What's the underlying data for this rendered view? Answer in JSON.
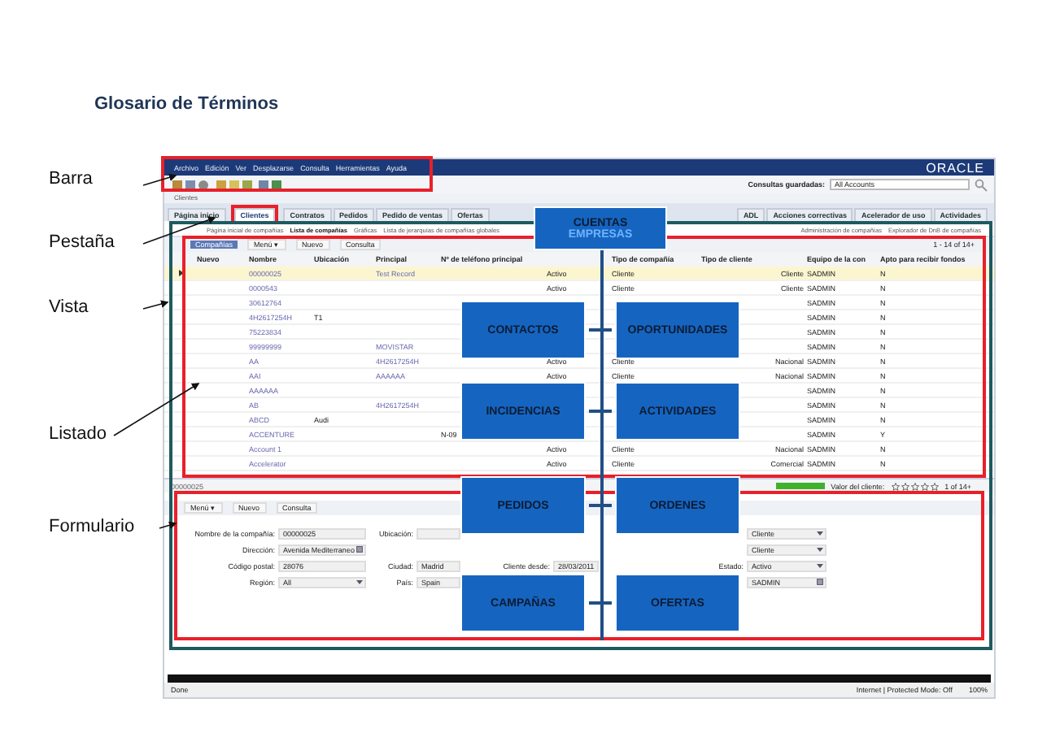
{
  "slide_title": "Glosario de Términos",
  "callouts": [
    {
      "label": "Barra"
    },
    {
      "label": "Pestaña"
    },
    {
      "label": "Vista"
    },
    {
      "label": "Listado"
    },
    {
      "label": "Formulario"
    }
  ],
  "app": {
    "menu": [
      "Archivo",
      "Edición",
      "Ver",
      "Desplazarse",
      "Consulta",
      "Herramientas",
      "Ayuda"
    ],
    "logo": "ORACLE",
    "saved_queries": {
      "label": "Consultas guardadas:",
      "value": "All Accounts"
    },
    "screen_label": "Clientes",
    "tabs": [
      {
        "label": "Página inicio",
        "selected": false
      },
      {
        "label": "Clientes",
        "selected": true
      },
      {
        "label": "Contratos",
        "selected": false
      },
      {
        "label": "Pedidos",
        "selected": false
      },
      {
        "label": "Pedido de ventas",
        "selected": false
      },
      {
        "label": "Ofertas",
        "selected": false
      },
      {
        "label": "ADL",
        "selected": false
      },
      {
        "label": "Acciones correctivas",
        "selected": false
      },
      {
        "label": "Acelerador de uso",
        "selected": false
      },
      {
        "label": "Actividades",
        "selected": false
      }
    ],
    "subtabs": [
      {
        "label": "Página inicial de compañías",
        "selected": false
      },
      {
        "label": "Lista de compañías",
        "selected": true
      },
      {
        "label": "Gráficas",
        "selected": false
      },
      {
        "label": "Lista de jerarquías de compañías globales",
        "selected": false
      },
      {
        "label": "Administración de compañías",
        "selected": false
      },
      {
        "label": "Explorador de DnB de compañías",
        "selected": false
      }
    ],
    "list": {
      "title": "Compañías",
      "menu": "Menú ▾",
      "buttons": [
        "Nuevo",
        "Consulta"
      ],
      "count": "1 - 14 of 14+",
      "columns": [
        "Nuevo",
        "Nombre",
        "Ubicación",
        "Principal",
        "Nº de teléfono principal",
        "Tipo de compañía",
        "Tipo de cliente",
        "Equipo de la con",
        "Apto para recibir fondos"
      ],
      "rows": [
        {
          "selected": true,
          "name": "00000025",
          "primary": "Test Record",
          "status": "Activo",
          "company_type": "Cliente",
          "client_type": "Cliente",
          "team": "SADMIN",
          "eligible": "N"
        },
        {
          "selected": false,
          "name": "0000543",
          "status": "Activo",
          "company_type": "Cliente",
          "client_type": "Cliente",
          "team": "SADMIN",
          "eligible": "N"
        },
        {
          "selected": false,
          "name": "30612764",
          "team": "SADMIN",
          "eligible": "N"
        },
        {
          "selected": false,
          "name": "4H2617254H",
          "location": "T1",
          "team": "SADMIN",
          "eligible": "N"
        },
        {
          "selected": false,
          "name": "75223834",
          "team": "SADMIN",
          "eligible": "N"
        },
        {
          "selected": false,
          "name": "99999999",
          "primary": "MOVISTAR",
          "team": "SADMIN",
          "eligible": "N"
        },
        {
          "selected": false,
          "name": "AA",
          "primary": "4H2617254H",
          "status": "Activo",
          "company_type": "Cliente",
          "client_type": "Nacional",
          "team": "SADMIN",
          "eligible": "N"
        },
        {
          "selected": false,
          "name": "AAI",
          "primary": "AAAAAA",
          "status": "Activo",
          "company_type": "Cliente",
          "client_type": "Nacional",
          "team": "SADMIN",
          "eligible": "N"
        },
        {
          "selected": false,
          "name": "AAAAAA",
          "team": "SADMIN",
          "eligible": "N"
        },
        {
          "selected": false,
          "name": "AB",
          "primary": "4H2617254H",
          "team": "SADMIN",
          "eligible": "N"
        },
        {
          "selected": false,
          "name": "ABCD",
          "location": "Audi",
          "team": "SADMIN",
          "eligible": "N"
        },
        {
          "selected": false,
          "name": "ACCENTURE",
          "phone": "N-09",
          "team": "SADMIN",
          "eligible": "Y"
        },
        {
          "selected": false,
          "name": "Account 1",
          "status": "Activo",
          "company_type": "Cliente",
          "client_type": "Nacional",
          "team": "SADMIN",
          "eligible": "N"
        },
        {
          "selected": false,
          "name": "Accelerator",
          "status": "Activo",
          "company_type": "Cliente",
          "client_type": "Comercial",
          "team": "SADMIN",
          "eligible": "N"
        }
      ]
    },
    "form": {
      "record": "00000025",
      "value_label": "Valor del cliente:",
      "value_bar": {
        "level": 1
      },
      "stars": 0,
      "count": "1 of 14+",
      "menu": "Menú ▾",
      "buttons": [
        "Nuevo",
        "Consulta"
      ],
      "rows": [
        [
          {
            "label": "Nombre de la compañía:",
            "value": "00000025",
            "kind": "text"
          },
          {
            "label": "Ubicación:",
            "kind": "text"
          },
          null,
          {
            "value": "Cliente",
            "kind": "dropdown"
          }
        ],
        [
          {
            "label": "Dirección:",
            "value": "Avenida Mediterraneo",
            "kind": "picker"
          },
          null,
          null,
          {
            "value": "Cliente",
            "kind": "dropdown"
          }
        ],
        [
          {
            "label": "Código postal:",
            "value": "28076",
            "kind": "text"
          },
          {
            "label": "Ciudad:",
            "value": "Madrid",
            "kind": "text"
          },
          {
            "label": "Cliente desde:",
            "value": "28/03/2011",
            "kind": "date"
          },
          {
            "label": "Estado:",
            "value": "Activo",
            "kind": "dropdown"
          }
        ],
        [
          {
            "label": "Región:",
            "value": "All",
            "kind": "dropdown"
          },
          {
            "label": "País:",
            "value": "Spain",
            "kind": "text"
          },
          null,
          {
            "value": "SADMIN",
            "kind": "picker"
          }
        ]
      ]
    },
    "status_bar": {
      "left": "Done",
      "zone": "Internet | Protected Mode: Off",
      "zoom": "100%"
    }
  },
  "entity_map": {
    "root": {
      "title": "CUENTAS",
      "subtitle": "EMPRESAS"
    },
    "pairs": [
      [
        "CONTACTOS",
        "OPORTUNIDADES"
      ],
      [
        "INCIDENCIAS",
        "ACTIVIDADES"
      ],
      [
        "PEDIDOS",
        "ORDENES"
      ],
      [
        "CAMPAÑAS",
        "OFERTAS"
      ]
    ]
  }
}
